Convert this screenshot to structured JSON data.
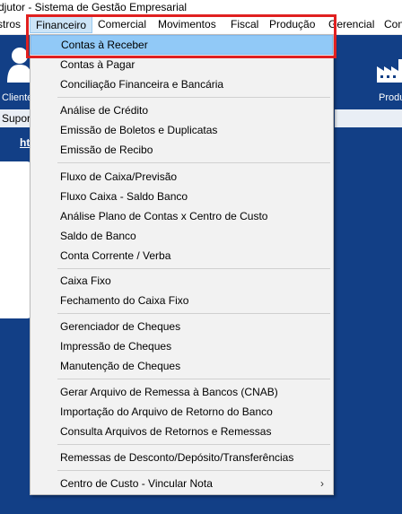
{
  "window": {
    "title": "djutor - Sistema de Gestão Empresarial"
  },
  "menubar": [
    {
      "id": "cadastros",
      "label": "stros"
    },
    {
      "id": "financeiro",
      "label": "Financeiro"
    },
    {
      "id": "comercial",
      "label": "Comercial"
    },
    {
      "id": "movimentos",
      "label": "Movimentos"
    },
    {
      "id": "fiscal",
      "label": "Fiscal"
    },
    {
      "id": "producao",
      "label": "Produção"
    },
    {
      "id": "gerencial",
      "label": "Gerencial"
    },
    {
      "id": "con",
      "label": "Con"
    }
  ],
  "background": {
    "clientes_label": "Cliente",
    "suporte_label": "Supor",
    "link_label": "ht",
    "producao_label": "Produ"
  },
  "dropdown": {
    "items": [
      {
        "label": "Contas à Receber",
        "selected": true
      },
      {
        "label": "Contas à Pagar"
      },
      {
        "label": "Conciliação Financeira e Bancária"
      },
      {
        "label": "Análise de Crédito"
      },
      {
        "label": "Emissão de Boletos e Duplicatas"
      },
      {
        "label": "Emissão de Recibo"
      },
      {
        "label": "Fluxo de Caixa/Previsão"
      },
      {
        "label": "Fluxo Caixa - Saldo Banco"
      },
      {
        "label": "Análise Plano de Contas x Centro de Custo"
      },
      {
        "label": "Saldo de Banco"
      },
      {
        "label": "Conta Corrente / Verba"
      },
      {
        "label": "Caixa Fixo"
      },
      {
        "label": "Fechamento do Caixa Fixo"
      },
      {
        "label": "Gerenciador de Cheques"
      },
      {
        "label": "Impressão de Cheques"
      },
      {
        "label": "Manutenção de Cheques"
      },
      {
        "label": "Gerar Arquivo de Remessa à Bancos (CNAB)"
      },
      {
        "label": "Importação  do Arquivo de Retorno do Banco"
      },
      {
        "label": "Consulta Arquivos de Retornos e Remessas"
      },
      {
        "label": "Remessas de Desconto/Depósito/Transferências"
      },
      {
        "label": "Centro de Custo - Vincular Nota",
        "submenu_arrow": "›"
      }
    ]
  },
  "colors": {
    "highlight_border": "#e02020",
    "selected_bg": "#91c9f7",
    "app_background": "#123f86"
  }
}
